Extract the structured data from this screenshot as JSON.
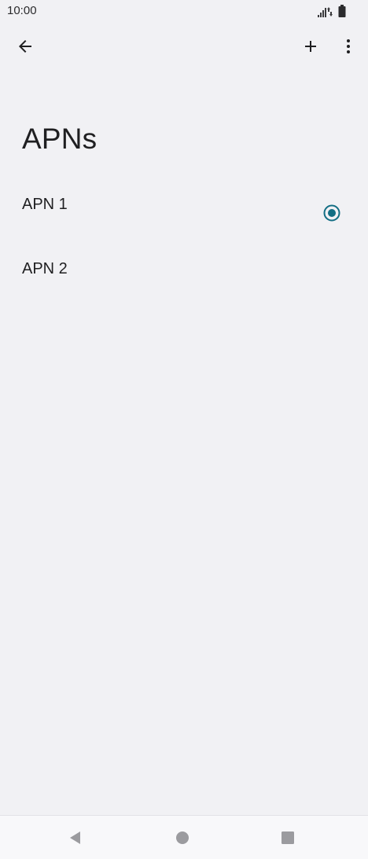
{
  "status_bar": {
    "time": "10:00",
    "signal_icon": "signal-icon",
    "battery_icon": "battery-icon"
  },
  "top_bar": {
    "back_icon": "arrow-back-icon",
    "add_icon": "plus-icon",
    "more_icon": "more-vert-icon"
  },
  "page": {
    "title": "APNs"
  },
  "apns": [
    {
      "label": "APN 1",
      "selected": true
    },
    {
      "label": "APN 2",
      "selected": false
    }
  ],
  "nav_bar": {
    "back_icon": "nav-back-icon",
    "home_icon": "nav-home-icon",
    "recents_icon": "nav-recents-icon"
  },
  "colors": {
    "background": "#f1f1f4",
    "accent": "#136e84",
    "text": "#1f1f21"
  }
}
